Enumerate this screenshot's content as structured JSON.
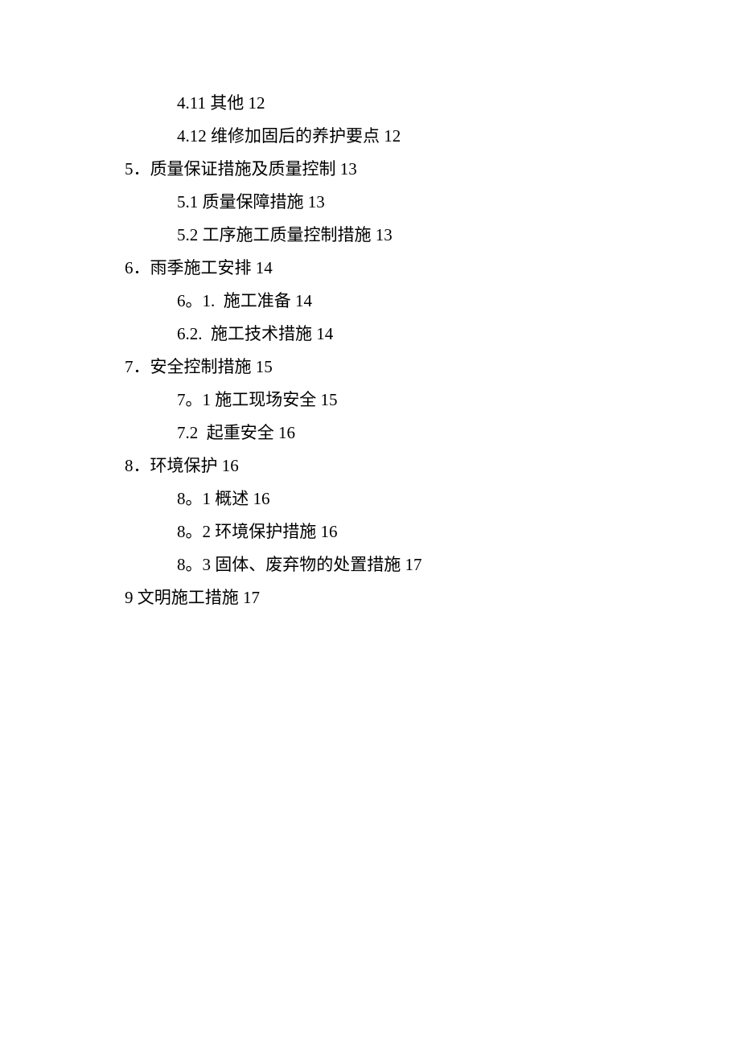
{
  "toc": [
    {
      "indent": 1,
      "text": "4.11 其他 12"
    },
    {
      "indent": 1,
      "text": "4.12 维修加固后的养护要点 12"
    },
    {
      "indent": 0,
      "text": "5．质量保证措施及质量控制 13"
    },
    {
      "indent": 1,
      "text": "5.1 质量保障措施 13"
    },
    {
      "indent": 1,
      "text": "5.2 工序施工质量控制措施 13"
    },
    {
      "indent": 0,
      "text": "6．雨季施工安排 14"
    },
    {
      "indent": 1,
      "text": "6。1.  施工准备 14"
    },
    {
      "indent": 1,
      "text": "6.2.  施工技术措施 14"
    },
    {
      "indent": 0,
      "text": "7．安全控制措施 15"
    },
    {
      "indent": 1,
      "text": "7。1 施工现场安全 15"
    },
    {
      "indent": 1,
      "text": "7.2  起重安全 16"
    },
    {
      "indent": 0,
      "text": "8．环境保护 16"
    },
    {
      "indent": 1,
      "text": "8。1 概述 16"
    },
    {
      "indent": 1,
      "text": "8。2 环境保护措施 16"
    },
    {
      "indent": 1,
      "text": "8。3 固体、废弃物的处置措施 17"
    },
    {
      "indent": 0,
      "text": "9 文明施工措施 17"
    }
  ]
}
